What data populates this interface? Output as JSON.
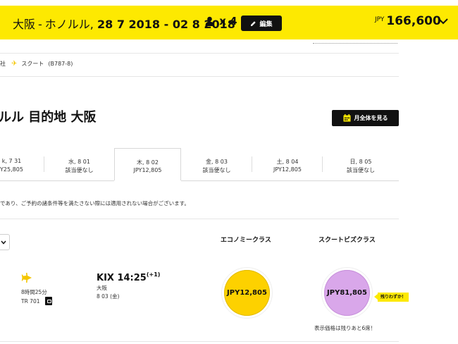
{
  "summary_bar": {
    "origin": "大阪",
    "separator": "-",
    "destination": "ホノルル,",
    "dates": "28 7 2018 - 02 8 2018",
    "passenger_count": "x 4",
    "edit_label": "編集",
    "total_currency": "JPY",
    "total_amount": "166,600",
    "colors": {
      "accent": "#fde901",
      "dark": "#111111"
    }
  },
  "airline_row": {
    "operator_label": "社",
    "airline": "スクート",
    "aircraft": "(B787-8)"
  },
  "page_title": "ルル 目的地 大阪",
  "month_button_label": "月全体を見る",
  "date_tabs": [
    {
      "date": "k, 7 31",
      "price": "Y25,805"
    },
    {
      "date": "水, 8 01",
      "price": "該当便なし"
    },
    {
      "date": "木, 8 02",
      "price": "JPY12,805",
      "active": true
    },
    {
      "date": "金, 8 03",
      "price": "該当便なし"
    },
    {
      "date": "土, 8 04",
      "price": "JPY12,805"
    },
    {
      "date": "日, 8 05",
      "price": "該当便なし"
    }
  ],
  "note": "であり、ご予約の諸条件等を満たさない際には適用されない場合がございます。",
  "filter_icon": "chevron-down-icon",
  "classes": {
    "economy": {
      "label": "エコノミークラス",
      "fare": "JPY12,805",
      "color": "#fdd100"
    },
    "business": {
      "label": "スクートビズクラス",
      "fare": "JPY81,805",
      "color": "#d9a7ea"
    }
  },
  "flight": {
    "duration": "8時間25分",
    "flight_number": "TR 701",
    "arrival_time": "KIX 14:25",
    "arrival_day_offset": "(+1)",
    "arrival_city": "大阪",
    "arrival_date": "8 03 (金)"
  },
  "badge_text": "残りわずか！",
  "seats_left_note": "表示価格は残りあと6席！"
}
